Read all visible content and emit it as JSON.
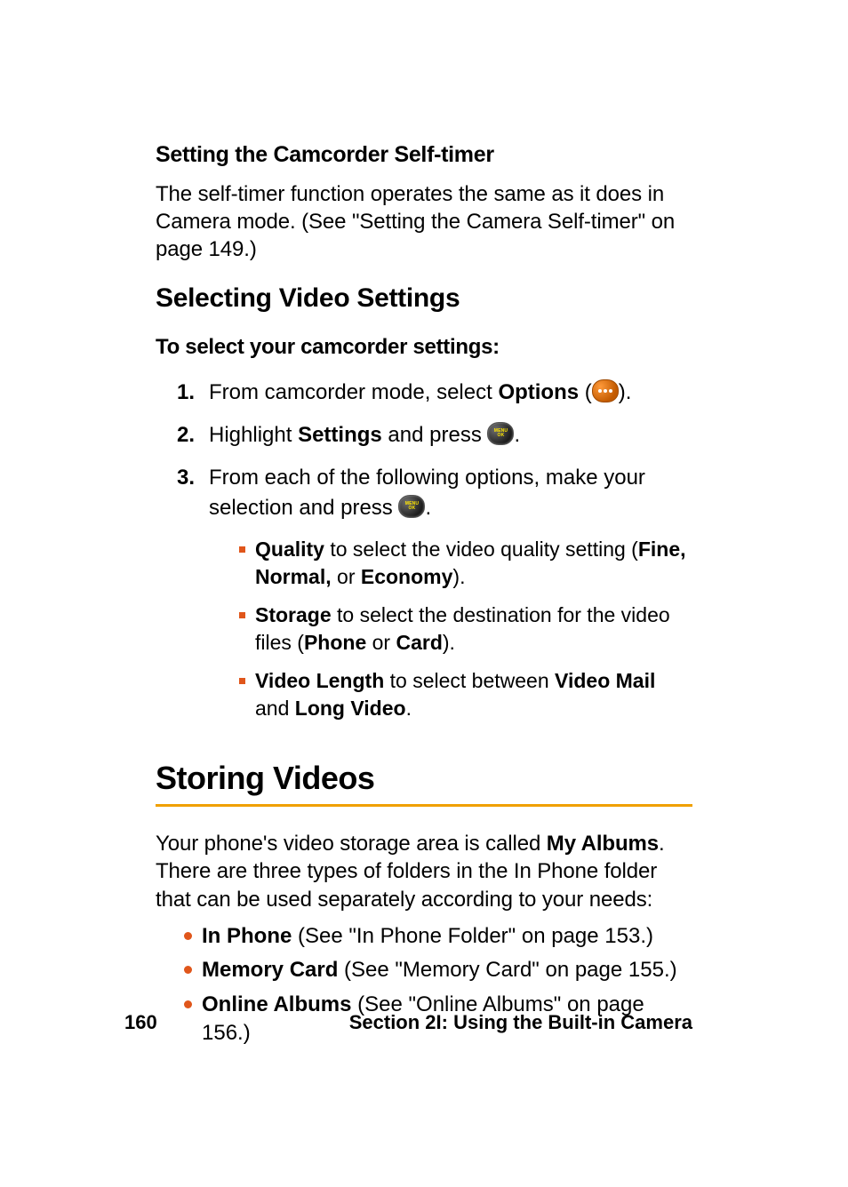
{
  "section_self_timer": {
    "heading": "Setting the Camcorder Self-timer",
    "body": "The self-timer function operates the same as it does in Camera mode. (See \"Setting the Camera Self-timer\" on page 149.)"
  },
  "section_video_settings": {
    "heading": "Selecting Video Settings",
    "subheading": "To select your camcorder settings:",
    "steps": [
      {
        "num": "1.",
        "text_pre": "From camcorder mode, select ",
        "bold": "Options",
        "text_post": " (",
        "icon": "options-softkey-icon",
        "text_close": ")."
      },
      {
        "num": "2.",
        "text_pre": "Highlight ",
        "bold": "Settings",
        "text_post": " and press ",
        "icon": "menu-ok-button-icon",
        "text_close": "."
      },
      {
        "num": "3.",
        "line1": "From each of the following options, make your selection and press ",
        "icon": "menu-ok-button-icon",
        "line1_close": "."
      }
    ],
    "sub_items": [
      {
        "bold": "Quality",
        "rest": " to select the video quality setting (",
        "b1": "Fine, Normal,",
        "mid": " or ",
        "b2": "Economy",
        "end": ")."
      },
      {
        "bold": "Storage",
        "rest": " to select the destination for the video files (",
        "b1": "Phone",
        "mid": " or ",
        "b2": "Card",
        "end": ")."
      },
      {
        "bold": "Video Length",
        "rest": " to select between ",
        "b1": "Video Mail",
        "mid": " and ",
        "b2": "Long Video",
        "end": "."
      }
    ]
  },
  "section_storing": {
    "heading": "Storing Videos",
    "intro_pre": "Your phone's video storage area is called ",
    "intro_bold": "My Albums",
    "intro_post": ". There are three types of folders in the In Phone folder that can be used separately according to your needs:",
    "items": [
      {
        "bold": "In Phone",
        "rest": " (See \"In Phone Folder\" on page 153.)"
      },
      {
        "bold": "Memory Card",
        "rest": " (See \"Memory Card\" on page 155.)"
      },
      {
        "bold": "Online Albums",
        "rest": " (See \"Online Albums\" on page 156.)"
      }
    ]
  },
  "footer": {
    "page": "160",
    "section": "Section 2I: Using the Built-in Camera"
  },
  "icons": {
    "menu_ok_line1": "MENU",
    "menu_ok_line2": "OK"
  }
}
